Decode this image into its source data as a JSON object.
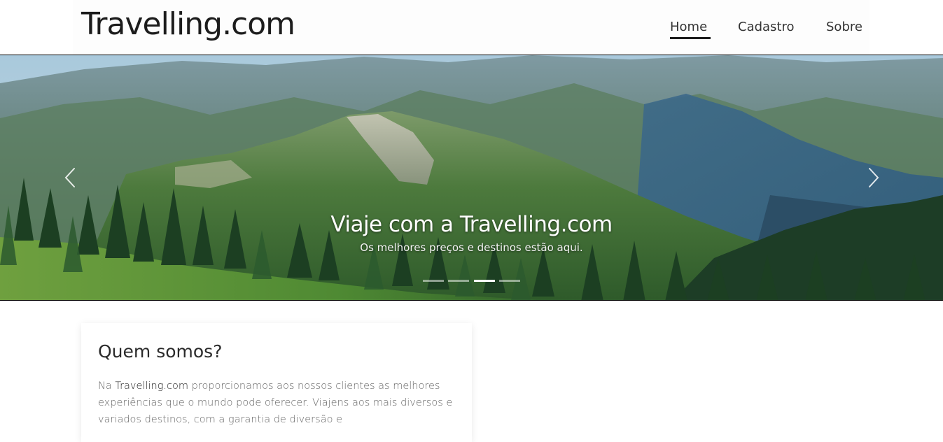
{
  "header": {
    "logo": "Travelling.com",
    "nav": [
      {
        "label": "Home",
        "active": true
      },
      {
        "label": "Cadastro",
        "active": false
      },
      {
        "label": "Sobre",
        "active": false
      }
    ]
  },
  "carousel": {
    "title_prefix": "Viaje com a ",
    "title_brand": "Travelling.com",
    "subtitle": "Os melhores preços e destinos estão aqui.",
    "slide_count": 4,
    "active_slide": 3
  },
  "about": {
    "title": "Quem somos?",
    "text_prefix": "Na ",
    "text_brand": "Travelling.com",
    "text_body": " proporcionamos aos nossos clientes as melhores experiências que o mundo pode oferecer. Viajens aos mais diversos e variados destinos, com a garantia de diversão e"
  },
  "colors": {
    "accent": "#1a1a1a",
    "sky": "#9fc3d6",
    "forest": "#1f4a2a"
  },
  "icons": {
    "prev": "chevron-left-icon",
    "next": "chevron-right-icon"
  }
}
